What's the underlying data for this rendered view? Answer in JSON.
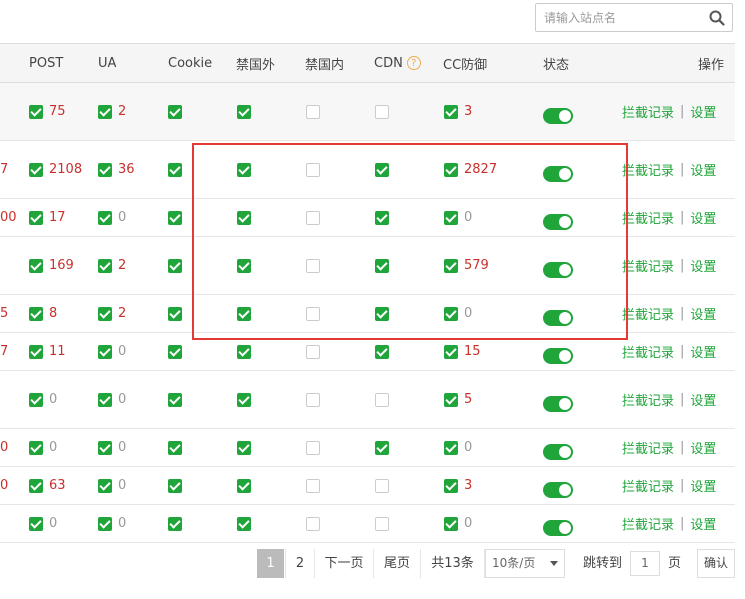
{
  "search": {
    "placeholder": "请输入站点名",
    "icon": "search-icon"
  },
  "columns": {
    "post": "POST",
    "ua": "UA",
    "cookie": "Cookie",
    "ban_foreign": "禁国外",
    "ban_domestic": "禁国内",
    "cdn": "CDN",
    "cc": "CC防御",
    "status": "状态",
    "ops": "操作"
  },
  "rows": [
    {
      "left": "",
      "post": "75",
      "ua": "2",
      "cookie": true,
      "foreign": true,
      "domestic": false,
      "cdn": false,
      "cc": "3",
      "status": true
    },
    {
      "left": "7",
      "post": "2108",
      "ua": "36",
      "cookie": true,
      "foreign": true,
      "domestic": false,
      "cdn": true,
      "cc": "2827",
      "status": true
    },
    {
      "left": "00",
      "post": "17",
      "ua": "0",
      "cookie": true,
      "foreign": true,
      "domestic": false,
      "cdn": true,
      "cc": "0",
      "status": true
    },
    {
      "left": "",
      "post": "169",
      "ua": "2",
      "cookie": true,
      "foreign": true,
      "domestic": false,
      "cdn": true,
      "cc": "579",
      "status": true
    },
    {
      "left": "5",
      "post": "8",
      "ua": "2",
      "cookie": true,
      "foreign": true,
      "domestic": false,
      "cdn": true,
      "cc": "0",
      "status": true
    },
    {
      "left": "7",
      "post": "11",
      "ua": "0",
      "cookie": true,
      "foreign": true,
      "domestic": false,
      "cdn": true,
      "cc": "15",
      "status": true
    },
    {
      "left": "",
      "post": "0",
      "ua": "0",
      "cookie": true,
      "foreign": true,
      "domestic": false,
      "cdn": false,
      "cc": "5",
      "status": true
    },
    {
      "left": "0",
      "post": "0",
      "ua": "0",
      "cookie": true,
      "foreign": true,
      "domestic": false,
      "cdn": true,
      "cc": "0",
      "status": true
    },
    {
      "left": "0",
      "post": "63",
      "ua": "0",
      "cookie": true,
      "foreign": true,
      "domestic": false,
      "cdn": false,
      "cc": "3",
      "status": true
    },
    {
      "left": "",
      "post": "0",
      "ua": "0",
      "cookie": true,
      "foreign": true,
      "domestic": false,
      "cdn": false,
      "cc": "0",
      "status": true
    }
  ],
  "ops": {
    "log": "拦截记录",
    "sep": "|",
    "settings": "设置"
  },
  "pagination": {
    "page1": "1",
    "page2": "2",
    "next": "下一页",
    "last": "尾页",
    "total": "共13条",
    "per_page": "10条/页",
    "goto": "跳转到",
    "goto_value": "1",
    "page_unit": "页",
    "confirm": "确认"
  },
  "colors": {
    "accent": "#20a53a",
    "danger": "#c9302c",
    "highlight_box": "#e53935"
  }
}
